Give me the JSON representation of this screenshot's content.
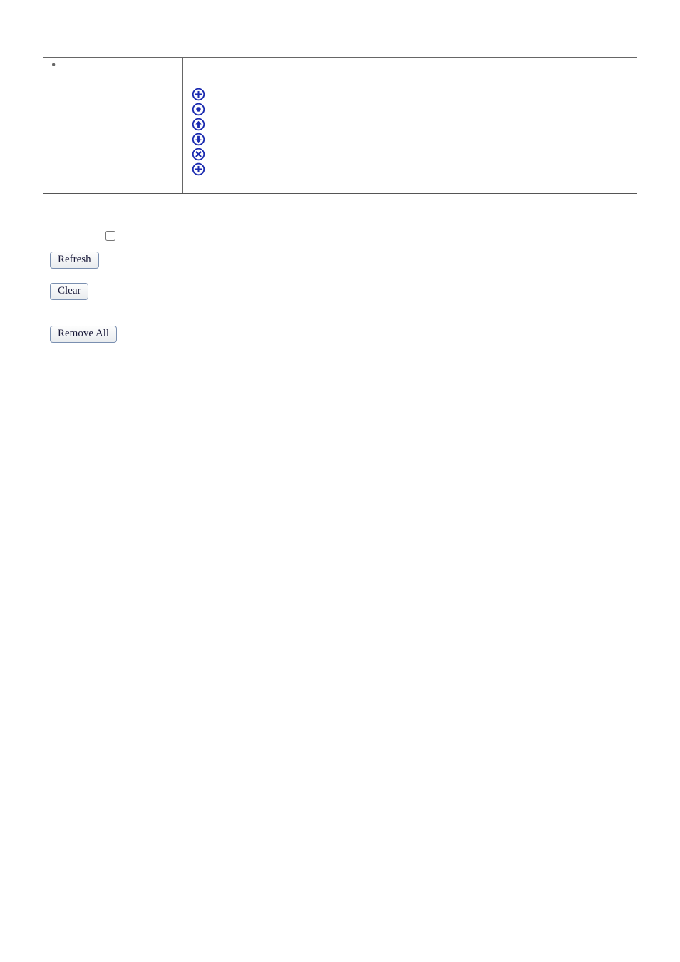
{
  "icons": {
    "plus_top": "plus-icon",
    "target": "target-icon",
    "up": "arrow-up-icon",
    "down": "arrow-down-icon",
    "remove": "x-icon",
    "plus_bottom": "plus-icon"
  },
  "icon_color": "#1a2ab0",
  "form": {
    "checkbox_checked": false
  },
  "buttons": {
    "refresh": "Refresh",
    "clear": "Clear",
    "remove_all": "Remove All"
  }
}
